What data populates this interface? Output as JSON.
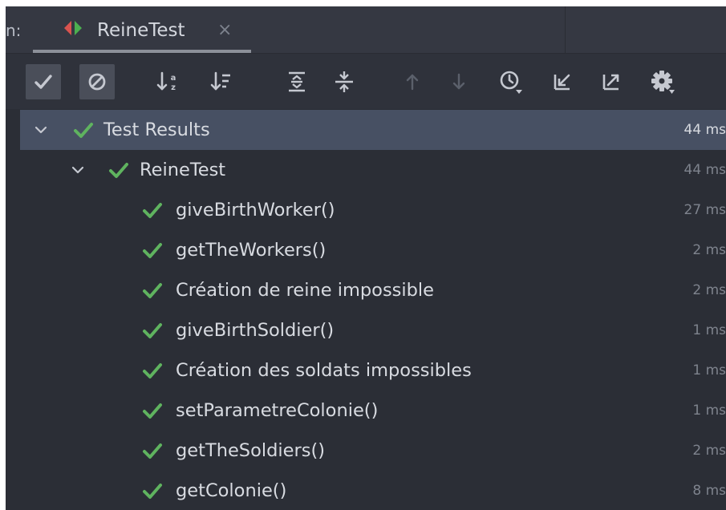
{
  "header": {
    "run_label": "n:",
    "tab": {
      "title": "ReineTest",
      "close_glyph": "×",
      "icon": "run-config-icon"
    }
  },
  "toolbar": {
    "buttons": [
      {
        "name": "show-passed-button",
        "icon": "check-icon",
        "toggled": true
      },
      {
        "name": "show-ignored-button",
        "icon": "ignored-icon",
        "toggled": true
      },
      {
        "name": "sort-alphabetically-button",
        "icon": "sort-alpha-icon",
        "toggled": false
      },
      {
        "name": "sort-by-duration-button",
        "icon": "sort-duration-icon",
        "toggled": false
      },
      {
        "name": "expand-all-button",
        "icon": "expand-all-icon",
        "toggled": false
      },
      {
        "name": "collapse-all-button",
        "icon": "collapse-all-icon",
        "toggled": false
      },
      {
        "name": "previous-failed-button",
        "icon": "arrow-up-icon",
        "toggled": false,
        "disabled": true
      },
      {
        "name": "next-failed-button",
        "icon": "arrow-down-icon",
        "toggled": false,
        "disabled": true
      },
      {
        "name": "test-history-button",
        "icon": "history-clock-icon",
        "toggled": false
      },
      {
        "name": "import-tests-button",
        "icon": "import-icon",
        "toggled": false
      },
      {
        "name": "export-tests-button",
        "icon": "export-icon",
        "toggled": false
      },
      {
        "name": "settings-button",
        "icon": "gear-icon",
        "toggled": false
      }
    ]
  },
  "tree": {
    "root": {
      "label": "Test Results",
      "time": "44 ms",
      "expanded": true,
      "selected": true
    },
    "suite": {
      "label": "ReineTest",
      "time": "44 ms",
      "expanded": true
    },
    "tests": [
      {
        "label": "giveBirthWorker()",
        "time": "27 ms"
      },
      {
        "label": "getTheWorkers()",
        "time": "2 ms"
      },
      {
        "label": "Création de reine impossible",
        "time": "2 ms"
      },
      {
        "label": "giveBirthSoldier()",
        "time": "1 ms"
      },
      {
        "label": "Création des soldats impossibles",
        "time": "1 ms"
      },
      {
        "label": "setParametreColonie()",
        "time": "1 ms"
      },
      {
        "label": "getTheSoldiers()",
        "time": "2 ms"
      },
      {
        "label": "getColonie()",
        "time": "8 ms"
      }
    ]
  },
  "colors": {
    "pass_green": "#5fb35f",
    "selection": "#475063",
    "background": "#2b2e36",
    "toolbar_icon": "#c5c8d0",
    "disabled_icon": "#5b606b",
    "tab_icon_red": "#d9534f",
    "tab_icon_green": "#4caf50"
  }
}
